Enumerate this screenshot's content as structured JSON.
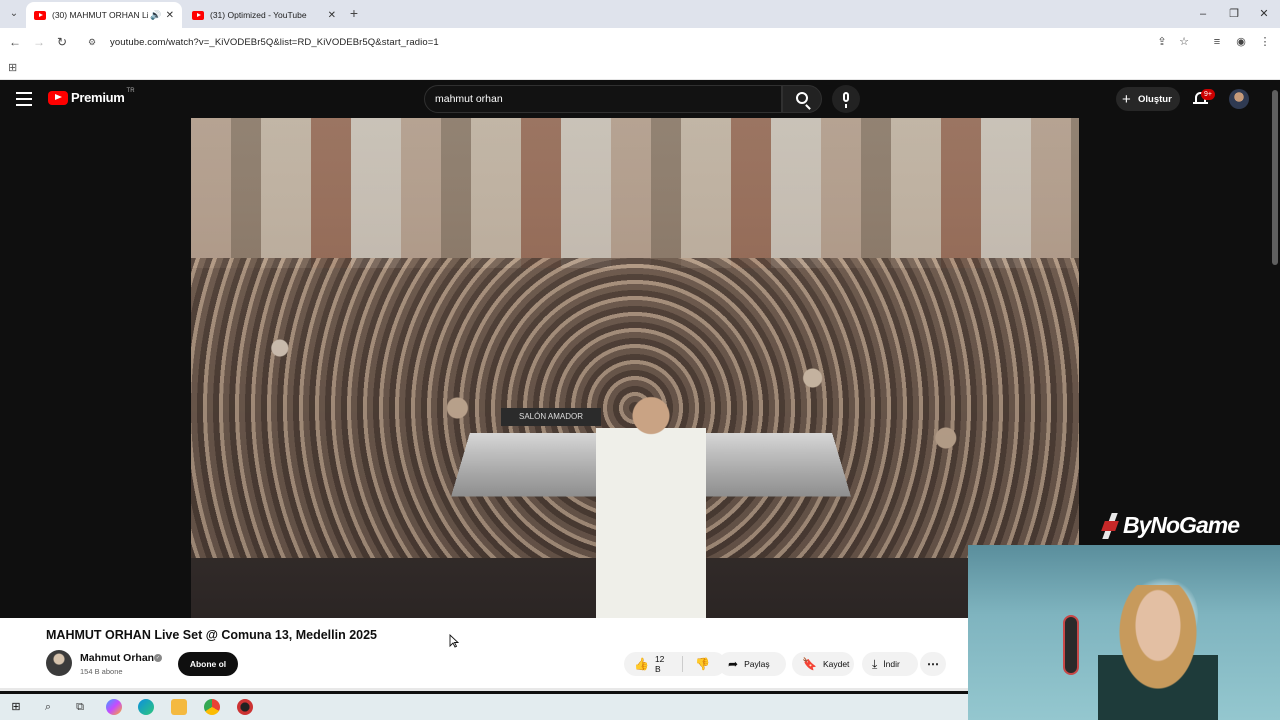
{
  "browser": {
    "tabs": [
      {
        "title": "(30) MAHMUT ORHAN Live Set @ Comuna 13, Medellin 2025",
        "active": true,
        "audio": true
      },
      {
        "title": "(31) Optimized - YouTube",
        "active": false
      }
    ],
    "url": "youtube.com/watch?v=_KiVODEBr5Q&list=RD_KiVODEBr5Q&start_radio=1"
  },
  "youtube": {
    "logo_text": "Premium",
    "logo_country": "TR",
    "search_value": "mahmut orhan",
    "create_label": "Oluştur",
    "notifications_badge": "9+"
  },
  "video": {
    "sign_text": "SALÓN AMADOR",
    "title": "MAHMUT ORHAN Live Set @ Comuna 13, Medellin 2025",
    "channel": "Mahmut Orhan",
    "subscribers": "154 B abone",
    "subscribe_label": "Abone ol",
    "likes": "12 B",
    "share_label": "Paylaş",
    "save_label": "Kaydet",
    "download_label": "İndir"
  },
  "overlay": {
    "brand": "ByNoGame"
  }
}
